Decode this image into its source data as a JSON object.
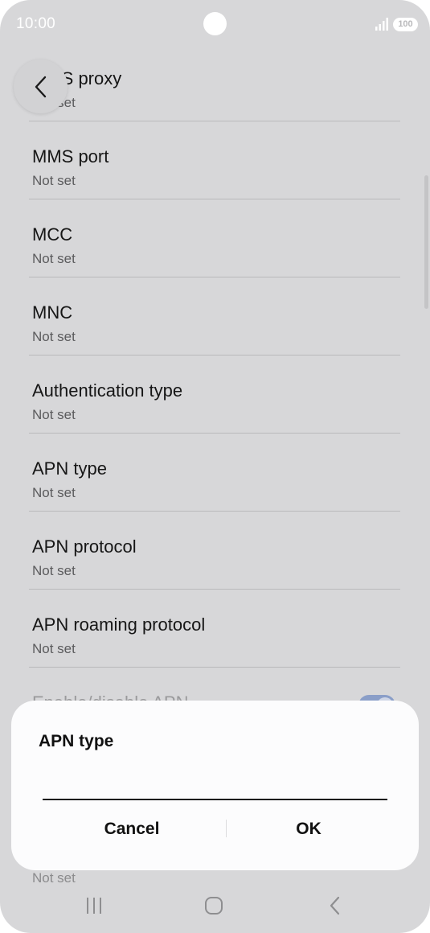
{
  "status_bar": {
    "time": "10:00",
    "battery": "100"
  },
  "list_items": [
    {
      "title": "MMS proxy",
      "subtitle": "Not set"
    },
    {
      "title": "MMS port",
      "subtitle": "Not set"
    },
    {
      "title": "MCC",
      "subtitle": "Not set"
    },
    {
      "title": "MNC",
      "subtitle": "Not set"
    },
    {
      "title": "Authentication type",
      "subtitle": "Not set"
    },
    {
      "title": "APN type",
      "subtitle": "Not set"
    },
    {
      "title": "APN protocol",
      "subtitle": "Not set"
    },
    {
      "title": "APN roaming protocol",
      "subtitle": "Not set"
    },
    {
      "title": "Enable/disable APN",
      "subtitle": ""
    }
  ],
  "peek_subtitle": "Not set",
  "dialog": {
    "title": "APN type",
    "input_value": "",
    "cancel_label": "Cancel",
    "ok_label": "OK"
  },
  "icons": {
    "back": "chevron-left-icon",
    "signal": "signal-icon",
    "nav_recents": "recents-icon",
    "nav_home": "home-icon",
    "nav_back": "back-arrow-icon"
  },
  "colors": {
    "dim_background": "#d7d7d9",
    "dialog_background": "#fcfcfd",
    "toggle_on": "#8a9ec8"
  }
}
